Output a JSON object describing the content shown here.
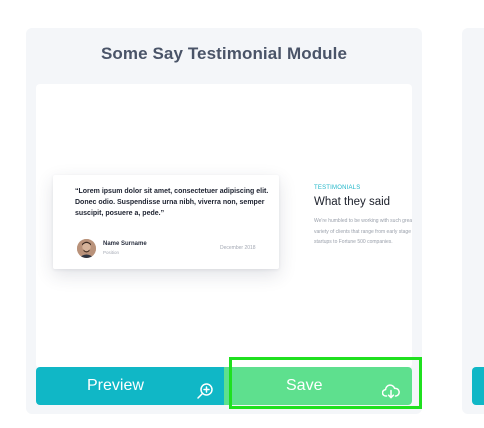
{
  "card": {
    "title": "Some Say Testimonial Module"
  },
  "preview": {
    "quote": "“Lorem ipsum dolor sit amet, consectetuer adipiscing elit. Donec odio. Suspendisse urna nibh, viverra non, semper suscipit, posuere a, pede.”",
    "person_name": "Name Surname",
    "person_role": "Position",
    "date": "December 2018",
    "eyebrow": "TESTIMONIALS",
    "heading": "What they said",
    "body": "We're humbled to be working with such great variety of clients that range from early stage startups to Fortune 500 companies."
  },
  "actions": {
    "preview_label": "Preview",
    "preview_icon": "zoom-in-icon",
    "save_label": "Save",
    "save_icon": "cloud-download-icon"
  },
  "colors": {
    "preview_button": "#10b7c6",
    "save_button": "#5ee08e",
    "accent": "#21b7c9",
    "card_background": "#f4f6f9",
    "highlight": "#1fe01f"
  }
}
